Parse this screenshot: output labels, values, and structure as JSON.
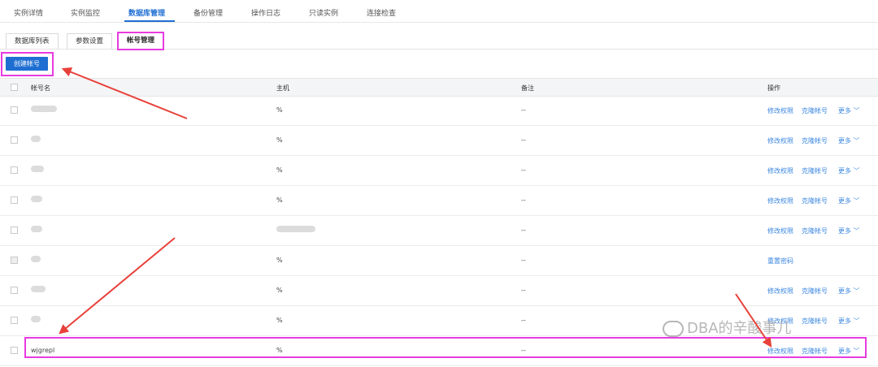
{
  "top_tabs": [
    "实例详情",
    "实例监控",
    "数据库管理",
    "备份管理",
    "操作日志",
    "只读实例",
    "连接检查"
  ],
  "sub_tabs": [
    "数据库列表",
    "参数设置",
    "帐号管理"
  ],
  "create_button": "创建帐号",
  "table": {
    "headers": {
      "account": "帐号名",
      "host": "主机",
      "remark": "备注",
      "actions": "操作"
    },
    "rows": [
      {
        "account": "",
        "host": "%",
        "remark": "--",
        "act1": "修改权限",
        "act2": "克隆帐号",
        "act3": "更多"
      },
      {
        "account": "",
        "host": "%",
        "remark": "--",
        "act1": "修改权限",
        "act2": "克隆帐号",
        "act3": "更多"
      },
      {
        "account": "",
        "host": "%",
        "remark": "--",
        "act1": "修改权限",
        "act2": "克隆帐号",
        "act3": "更多"
      },
      {
        "account": "",
        "host": "%",
        "remark": "--",
        "act1": "修改权限",
        "act2": "克隆帐号",
        "act3": "更多"
      },
      {
        "account": "",
        "host": "",
        "remark": "--",
        "act1": "修改权限",
        "act2": "克隆帐号",
        "act3": "更多"
      },
      {
        "account": "",
        "host": "%",
        "remark": "--",
        "act1": "重置密码",
        "act2": "",
        "act3": ""
      },
      {
        "account": "",
        "host": "%",
        "remark": "--",
        "act1": "修改权限",
        "act2": "克隆帐号",
        "act3": "更多"
      },
      {
        "account": "",
        "host": "%",
        "remark": "--",
        "act1": "修改权限",
        "act2": "克隆帐号",
        "act3": "更多"
      },
      {
        "account": "wjgrepl",
        "host": "%",
        "remark": "--",
        "act1": "修改权限",
        "act2": "克隆帐号",
        "act3": "更多"
      }
    ]
  },
  "watermark": "DBA的辛酸事儿",
  "colors": {
    "accent": "#1f6fd3",
    "link": "#3b87e0",
    "highlight": "#e73be0",
    "arrow": "#e8413a"
  }
}
